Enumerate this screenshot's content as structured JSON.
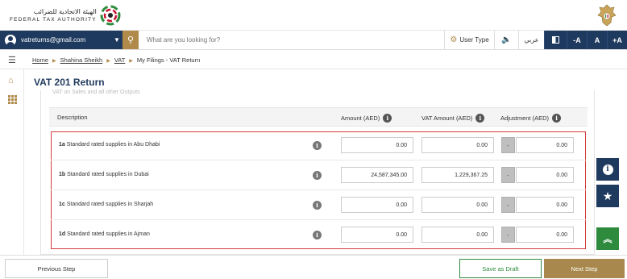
{
  "header": {
    "logo_ar": "الهيئة الاتحادية للضرائب",
    "logo_en": "FEDERAL TAX AUTHORITY",
    "colors": {
      "brand_gold": "#b08a4a",
      "brand_navy": "#1f3a5f",
      "green": "#2e8b3e",
      "highlight_red": "#d43a3a"
    }
  },
  "topbar": {
    "user_email": "vatreturns@gmail.com",
    "search_placeholder": "What are you looking for?",
    "user_type_label": "User Type",
    "language_label": "عربي",
    "font_decrease": "-A",
    "font_normal": "A",
    "font_increase": "+A"
  },
  "breadcrumb": [
    "Home",
    "Shahina Sheikh",
    "VAT",
    "My Filings - VAT Return"
  ],
  "page_title": "VAT 201 Return",
  "table": {
    "ghost_text": "VAT on Sales and all other Outputs",
    "columns": {
      "description": "Description",
      "amount": "Amount (AED)",
      "vat_amount": "VAT Amount (AED)",
      "adjustment": "Adjustment (AED)"
    },
    "rows": [
      {
        "code": "1a",
        "label": "Standard rated supplies in Abu Dhabi",
        "amount": "0.00",
        "vat": "0.00",
        "adjustment": "0.00"
      },
      {
        "code": "1b",
        "label": "Standard rated supplies in Dubai",
        "amount": "24,587,345.00",
        "vat": "1,229,367.25",
        "adjustment": "0.00"
      },
      {
        "code": "1c",
        "label": "Standard rated supplies in Sharjah",
        "amount": "0.00",
        "vat": "0.00",
        "adjustment": "0.00"
      },
      {
        "code": "1d",
        "label": "Standard rated supplies in Ajman",
        "amount": "0.00",
        "vat": "0.00",
        "adjustment": "0.00"
      }
    ],
    "adjustment_minus": "-"
  },
  "footer": {
    "previous_label": "Previous Step",
    "draft_label": "Save as Draft",
    "next_label": "Next Step"
  }
}
